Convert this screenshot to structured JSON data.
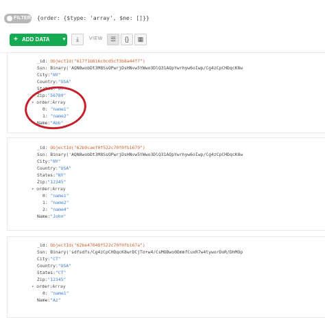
{
  "filter": {
    "chip_label": "FILTER",
    "query": "{order: {$type: 'array', $ne: []}}"
  },
  "toolbar": {
    "add_data_label": "ADD DATA",
    "view_label": "VIEW",
    "icons": [
      "plus-icon",
      "caret-down-icon",
      "import-icon",
      "list-view-icon",
      "json-view-icon",
      "table-view-icon"
    ]
  },
  "documents": [
    {
      "id_key": "_id:",
      "id_val": "ObjectId(\"617f1b816c0cd5cf3b8a44f7\")",
      "ssn": "Ssn: Binary('AQN8wobDt3M8SsOPwrjDsHNvw5YWwo3DlQ31AQpYwrhyw6oIwp/Cg4zCpCHDqcK8w",
      "city_k": "City:",
      "city_v": "\"NY\"",
      "country_k": "Country:",
      "country_v": "\"USA\"",
      "states_k": "States:",
      "states_v": "\"NY\"",
      "zip_k": "Zip:",
      "zip_v": "\"56789\"",
      "order_k": "order:",
      "order_v": "Array",
      "items": [
        {
          "k": "0:",
          "v": "\"name1\""
        },
        {
          "k": "1:",
          "v": "\"name2\""
        }
      ],
      "name_k": "Name:",
      "name_v": "\"Abb\""
    },
    {
      "id_key": "_id:",
      "id_val": "ObjectId(\"62b9caef0f522c70f0fb1679\")",
      "ssn": "Ssn: Binary('AQN8wobDt3M8SsOPwrjDsHNvw5YWwo3DlQ31AQpYwrhyw6oIwp/Cg4zCpCHDqcK8w",
      "city_k": "City:",
      "city_v": "\"NY\"",
      "country_k": "Country:",
      "country_v": "\"USA\"",
      "states_k": "States:",
      "states_v": "\"NY\"",
      "zip_k": "Zip:",
      "zip_v": "\"12345\"",
      "order_k": "order:",
      "order_v": "Array",
      "items": [
        {
          "k": "0:",
          "v": "\"name1\""
        },
        {
          "k": "1:",
          "v": "\"name2\""
        },
        {
          "k": "2:",
          "v": "\"name4\""
        }
      ],
      "name_k": "Name:",
      "name_v": "\"John\""
    },
    {
      "id_key": "_id:",
      "id_val": "ObjectId(\"62be47048f522c70f0fb167a\")",
      "ssn": "Ssn: Binary('sdfsdfs/Cg4zCpCHDqcK8wrDCjTo+w4/CsMOBwo0DmmfCuxR7w4tyworDoR/DhMOp",
      "city_k": "City:",
      "city_v": "\"CT\"",
      "country_k": "Country:",
      "country_v": "\"USA\"",
      "states_k": "States:",
      "states_v": "\"CT\"",
      "zip_k": "Zip:",
      "zip_v": "\"12345\"",
      "order_k": "order:",
      "order_v": "Array",
      "items": [
        {
          "k": "0:",
          "v": "\"name1\""
        }
      ],
      "name_k": "Name:",
      "name_v": "\"Az\""
    }
  ]
}
